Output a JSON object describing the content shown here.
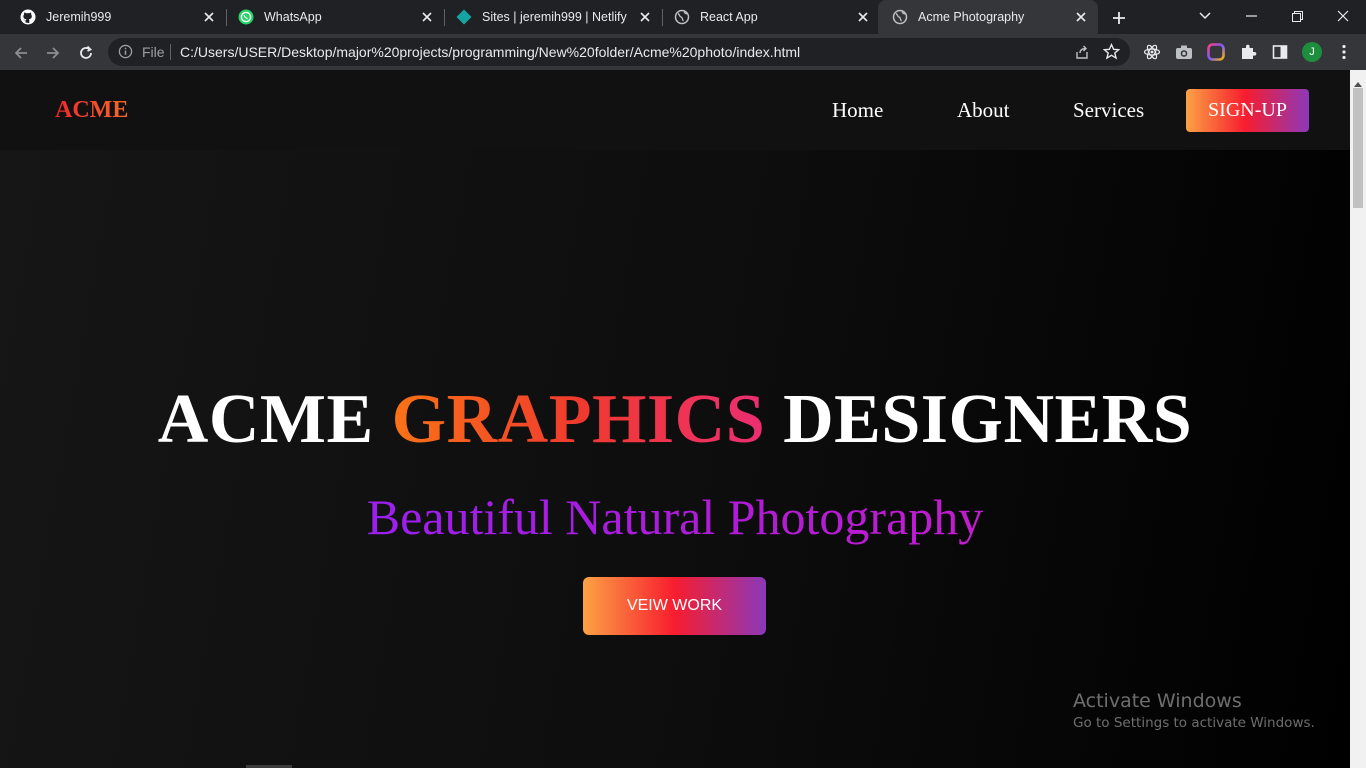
{
  "browser": {
    "tabs": [
      {
        "title": "Jeremih999",
        "icon": "github-icon"
      },
      {
        "title": "WhatsApp",
        "icon": "whatsapp-icon"
      },
      {
        "title": "Sites | jeremih999 | Netlify",
        "icon": "netlify-icon"
      },
      {
        "title": "React App",
        "icon": "globe-icon"
      },
      {
        "title": "Acme Photography",
        "icon": "globe-icon",
        "active": true
      }
    ],
    "address": {
      "scheme": "File",
      "url": "C:/Users/USER/Desktop/major%20projects/programming/New%20folder/Acme%20photo/index.html"
    },
    "profile_initial": "J"
  },
  "site": {
    "logo": "ACME",
    "nav": {
      "home": "Home",
      "about": "About",
      "services": "Services",
      "signup": "SIGN-UP"
    },
    "hero": {
      "title_part1": "ACME",
      "title_accent": "GRAPHICS",
      "title_part2": "DESIGNERS",
      "subtitle": "Beautiful Natural Photography",
      "cta": "VEIW WORK"
    }
  },
  "os": {
    "watermark_title": "Activate Windows",
    "watermark_sub": "Go to Settings to activate Windows."
  },
  "colors": {
    "logo": "#f3262b",
    "accent_orange": "#f97316",
    "accent_pink": "#ec2e72",
    "subtitle_purple": "#9c1ff0",
    "button_start": "#fca244",
    "button_mid": "#f71d2f",
    "button_end": "#8c38b9"
  }
}
